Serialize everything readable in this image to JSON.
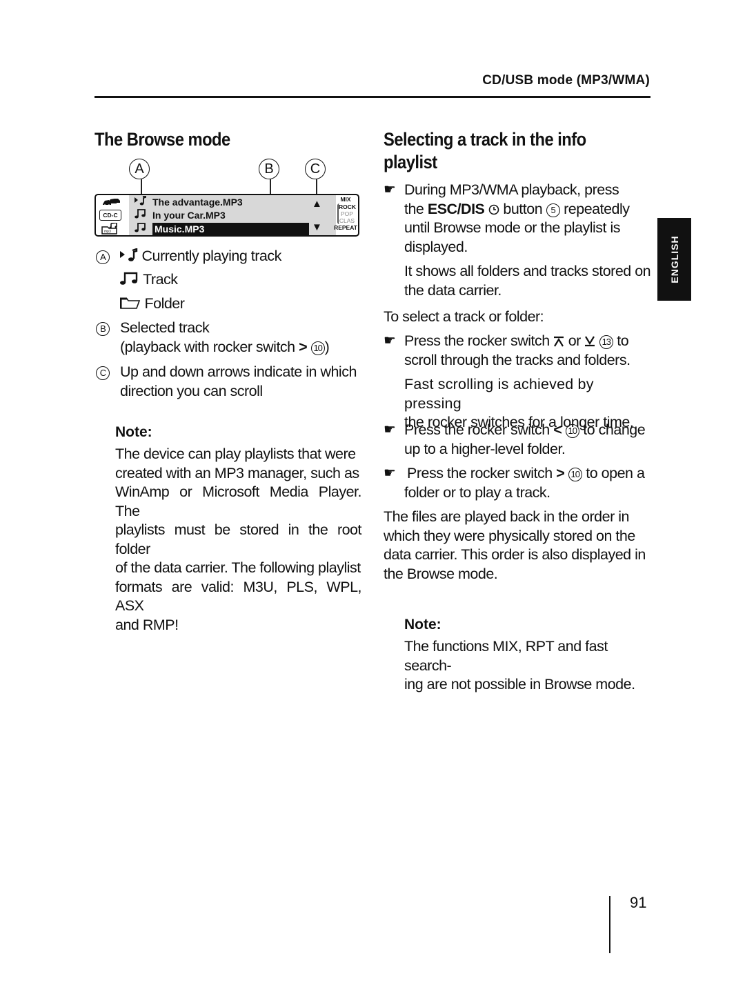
{
  "header": {
    "section_title": "CD/USB mode (MP3/WMA)"
  },
  "side_tab": {
    "label": "ENGLISH"
  },
  "page_number": "91",
  "left": {
    "title": "The Browse mode",
    "callouts": [
      "A",
      "B",
      "C"
    ],
    "display": {
      "left_icons": [
        "traffic-cars-icon",
        "cd-changer-icon",
        "mp3-folder-icon"
      ],
      "cd_changer_label": "CD-C",
      "rows": [
        {
          "icon": "playing-track-icon",
          "text": "The advantage.MP3",
          "selected": false
        },
        {
          "icon": "track-icon",
          "text": "In your Car.MP3",
          "selected": false
        },
        {
          "icon": "track-icon",
          "text": "Music.MP3",
          "selected": true
        }
      ],
      "scroll_up": "▲",
      "scroll_down": "▼",
      "right_labels": {
        "mix": "MIX",
        "eq": [
          "ROCK",
          "POP",
          "CLAS"
        ],
        "repeat": "REPEAT"
      }
    },
    "legend": {
      "a_label": "A",
      "a_items": [
        {
          "icon": "playing-track-icon",
          "text": "Currently playing track"
        },
        {
          "icon": "track-icon",
          "text": "Track"
        },
        {
          "icon": "folder-icon",
          "text": "Folder"
        }
      ],
      "b_label": "B",
      "b_text_1": "Selected track",
      "b_text_2": "(playback with rocker switch",
      "b_ref": "10",
      "b_text_end": ")",
      "c_label": "C",
      "c_text_1": "Up and down arrows indicate in which",
      "c_text_2": "direction you can scroll"
    },
    "note": {
      "label": "Note:",
      "lines": [
        "The device can play playlists that were",
        "created with an MP3 manager, such as",
        "WinAmp or Microsoft Media Player. The",
        "playlists must be stored in the root folder",
        "of the data carrier. The following playlist",
        "formats are valid: M3U, PLS, WPL, ASX",
        "and RMP!"
      ]
    }
  },
  "right": {
    "title_line1": "Selecting a track in the info",
    "title_line2": "playlist",
    "step1": {
      "line1": "During MP3/WMA playback, press",
      "line2_pre": "the",
      "line2_bold": "ESC/DIS",
      "line2_mid": "button",
      "line2_ref": "5",
      "line2_post": "repeatedly",
      "line3": "until Browse mode or the playlist is",
      "line4": "displayed.",
      "sub1": "It shows all folders and tracks stored on",
      "sub2": "the data carrier."
    },
    "intro": "To select a track or folder:",
    "step2": {
      "pre": "Press the rocker switch",
      "or": "or",
      "ref": "13",
      "post": "to",
      "line2": "scroll through the tracks and folders.",
      "sub1": "Fast scrolling is achieved by pressing",
      "sub2": "the rocker switches for a longer time."
    },
    "step3": {
      "pre": "Press the rocker switch",
      "ref": "10",
      "post": "to change",
      "line2": "up to a higher-level folder."
    },
    "step4": {
      "pre": "Press the rocker switch",
      "ref": "10",
      "post": "to open a",
      "line2": "folder or to play a track."
    },
    "paragraph": [
      "The files are played back in the order in",
      "which they were physically stored on the",
      "data carrier. This order is also displayed in",
      "the Browse mode."
    ],
    "note": {
      "label": "Note:",
      "lines": [
        "The functions MIX, RPT and fast search-",
        "ing are not possible in Browse mode."
      ]
    }
  }
}
